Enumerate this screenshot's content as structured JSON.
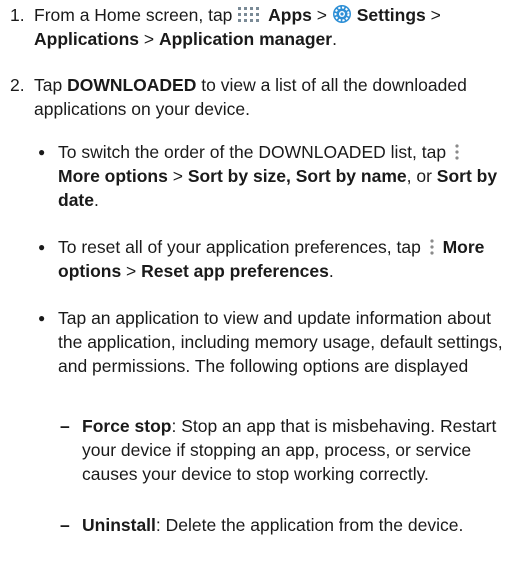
{
  "step1": {
    "number": "1.",
    "prefix": "From a Home screen, tap ",
    "apps": "Apps",
    "sep1": " > ",
    "settings": "Settings",
    "sep2": " > ",
    "applications": "Applications",
    "sep3": " > ",
    "app_manager": "Application manager",
    "end": "."
  },
  "step2": {
    "number": "2.",
    "prefix": "Tap ",
    "downloaded": "DOWNLOADED",
    "rest": " to view a list of all the downloaded applications on your device."
  },
  "bullet1": {
    "prefix": "To switch the order of the DOWNLOADED list, tap ",
    "more_options": "More options",
    "sep": " > ",
    "sort_size": "Sort by size, Sort by name",
    "or": ", or ",
    "sort_date": "Sort by date",
    "end": "."
  },
  "bullet2": {
    "prefix": "To reset all of your application preferences, tap ",
    "more_options": "More options",
    "sep": " > ",
    "reset": "Reset app preferences",
    "end": "."
  },
  "bullet3": {
    "text": "Tap an application to view and update information about the application, including memory usage, default settings, and permissions. The following options are displayed"
  },
  "sub1": {
    "dash": "–",
    "label": "Force stop",
    "text": ": Stop an app that is misbehaving. Restart your device if stopping an app, process, or service causes your device to stop working correctly."
  },
  "sub2": {
    "dash": "–",
    "label": "Uninstall",
    "text": ": Delete the application from the device."
  },
  "icons": {
    "apps": "apps-grid-icon",
    "settings": "settings-gear-icon",
    "more": "more-options-icon"
  },
  "colors": {
    "apps_icon": "#7a8a96",
    "settings_icon": "#2d8fd6"
  }
}
